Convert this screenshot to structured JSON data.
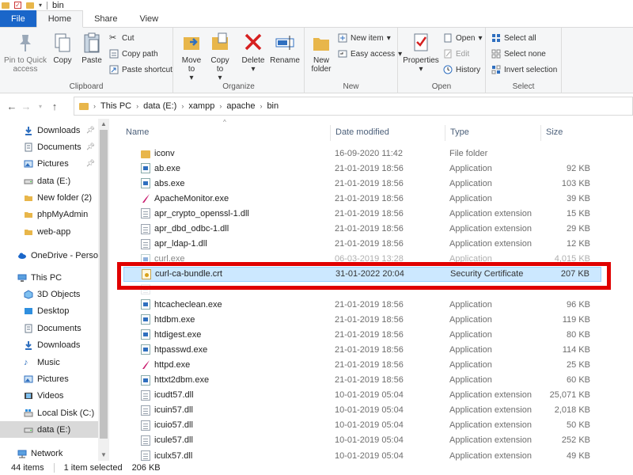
{
  "window": {
    "title": "bin"
  },
  "ribbon_tabs": [
    "File",
    "Home",
    "Share",
    "View"
  ],
  "ribbon": {
    "clipboard": {
      "label": "Clipboard",
      "pin": "Pin to Quick access",
      "copy": "Copy",
      "paste": "Paste",
      "cut": "Cut",
      "copy_path": "Copy path",
      "paste_shortcut": "Paste shortcut"
    },
    "organize": {
      "label": "Organize",
      "move_to": "Move to",
      "copy_to": "Copy to",
      "delete": "Delete",
      "rename": "Rename"
    },
    "new": {
      "label": "New",
      "new_folder": "New folder",
      "new_item": "New item",
      "easy_access": "Easy access"
    },
    "open": {
      "label": "Open",
      "properties": "Properties",
      "open": "Open",
      "edit": "Edit",
      "history": "History"
    },
    "select": {
      "label": "Select",
      "select_all": "Select all",
      "select_none": "Select none",
      "invert": "Invert selection"
    }
  },
  "address": {
    "crumbs": [
      "This PC",
      "data (E:)",
      "xampp",
      "apache",
      "bin"
    ]
  },
  "nav": {
    "quick": [
      {
        "label": "Downloads",
        "icon": "download-icon",
        "pinned": true
      },
      {
        "label": "Documents",
        "icon": "documents-icon",
        "pinned": true
      },
      {
        "label": "Pictures",
        "icon": "pictures-icon",
        "pinned": true
      },
      {
        "label": "data (E:)",
        "icon": "drive-icon",
        "pinned": false
      },
      {
        "label": "New folder (2)",
        "icon": "folder-icon",
        "pinned": false
      },
      {
        "label": "phpMyAdmin",
        "icon": "folder-icon",
        "pinned": false
      },
      {
        "label": "web-app",
        "icon": "folder-icon",
        "pinned": false
      }
    ],
    "onedrive": "OneDrive - Person",
    "thispc": "This PC",
    "pc_items": [
      {
        "label": "3D Objects",
        "icon": "3d-objects-icon"
      },
      {
        "label": "Desktop",
        "icon": "desktop-icon"
      },
      {
        "label": "Documents",
        "icon": "documents-icon"
      },
      {
        "label": "Downloads",
        "icon": "download-icon"
      },
      {
        "label": "Music",
        "icon": "music-icon"
      },
      {
        "label": "Pictures",
        "icon": "pictures-icon"
      },
      {
        "label": "Videos",
        "icon": "videos-icon"
      },
      {
        "label": "Local Disk (C:)",
        "icon": "drive-icon"
      },
      {
        "label": "data (E:)",
        "icon": "drive-icon"
      }
    ],
    "network": "Network"
  },
  "columns": {
    "name": "Name",
    "date": "Date modified",
    "type": "Type",
    "size": "Size"
  },
  "files": [
    {
      "name": "iconv",
      "date": "16-09-2020 11:42",
      "type": "File folder",
      "size": "",
      "kind": "folder"
    },
    {
      "name": "ab.exe",
      "date": "21-01-2019 18:56",
      "type": "Application",
      "size": "92 KB",
      "kind": "exe"
    },
    {
      "name": "abs.exe",
      "date": "21-01-2019 18:56",
      "type": "Application",
      "size": "103 KB",
      "kind": "exe"
    },
    {
      "name": "ApacheMonitor.exe",
      "date": "21-01-2019 18:56",
      "type": "Application",
      "size": "39 KB",
      "kind": "apache"
    },
    {
      "name": "apr_crypto_openssl-1.dll",
      "date": "21-01-2019 18:56",
      "type": "Application extension",
      "size": "15 KB",
      "kind": "dll"
    },
    {
      "name": "apr_dbd_odbc-1.dll",
      "date": "21-01-2019 18:56",
      "type": "Application extension",
      "size": "29 KB",
      "kind": "dll"
    },
    {
      "name": "apr_ldap-1.dll",
      "date": "21-01-2019 18:56",
      "type": "Application extension",
      "size": "12 KB",
      "kind": "dll"
    },
    {
      "name": "curl.exe",
      "date": "06-03-2019 13:28",
      "type": "Application",
      "size": "4,015 KB",
      "kind": "exe",
      "partial": true
    },
    {
      "name": "curl-ca-bundle.crt",
      "date": "31-01-2022 20:04",
      "type": "Security Certificate",
      "size": "207 KB",
      "kind": "cert",
      "selected": true
    },
    {
      "name": "",
      "date": "",
      "type": "",
      "size": "",
      "kind": "blank"
    },
    {
      "name": "htcacheclean.exe",
      "date": "21-01-2019 18:56",
      "type": "Application",
      "size": "96 KB",
      "kind": "exe"
    },
    {
      "name": "htdbm.exe",
      "date": "21-01-2019 18:56",
      "type": "Application",
      "size": "119 KB",
      "kind": "exe"
    },
    {
      "name": "htdigest.exe",
      "date": "21-01-2019 18:56",
      "type": "Application",
      "size": "80 KB",
      "kind": "exe"
    },
    {
      "name": "htpasswd.exe",
      "date": "21-01-2019 18:56",
      "type": "Application",
      "size": "114 KB",
      "kind": "exe"
    },
    {
      "name": "httpd.exe",
      "date": "21-01-2019 18:56",
      "type": "Application",
      "size": "25 KB",
      "kind": "httpd"
    },
    {
      "name": "httxt2dbm.exe",
      "date": "21-01-2019 18:56",
      "type": "Application",
      "size": "60 KB",
      "kind": "exe"
    },
    {
      "name": "icudt57.dll",
      "date": "10-01-2019 05:04",
      "type": "Application extension",
      "size": "25,071 KB",
      "kind": "dll"
    },
    {
      "name": "icuin57.dll",
      "date": "10-01-2019 05:04",
      "type": "Application extension",
      "size": "2,018 KB",
      "kind": "dll"
    },
    {
      "name": "icuio57.dll",
      "date": "10-01-2019 05:04",
      "type": "Application extension",
      "size": "50 KB",
      "kind": "dll"
    },
    {
      "name": "icule57.dll",
      "date": "10-01-2019 05:04",
      "type": "Application extension",
      "size": "252 KB",
      "kind": "dll"
    },
    {
      "name": "iculx57.dll",
      "date": "10-01-2019 05:04",
      "type": "Application extension",
      "size": "49 KB",
      "kind": "dll"
    }
  ],
  "status": {
    "count": "44 items",
    "selected": "1 item selected",
    "size": "206 KB"
  },
  "colors": {
    "accent": "#1a66c9",
    "selection": "#cce8ff",
    "highlight_box": "#e00000"
  }
}
